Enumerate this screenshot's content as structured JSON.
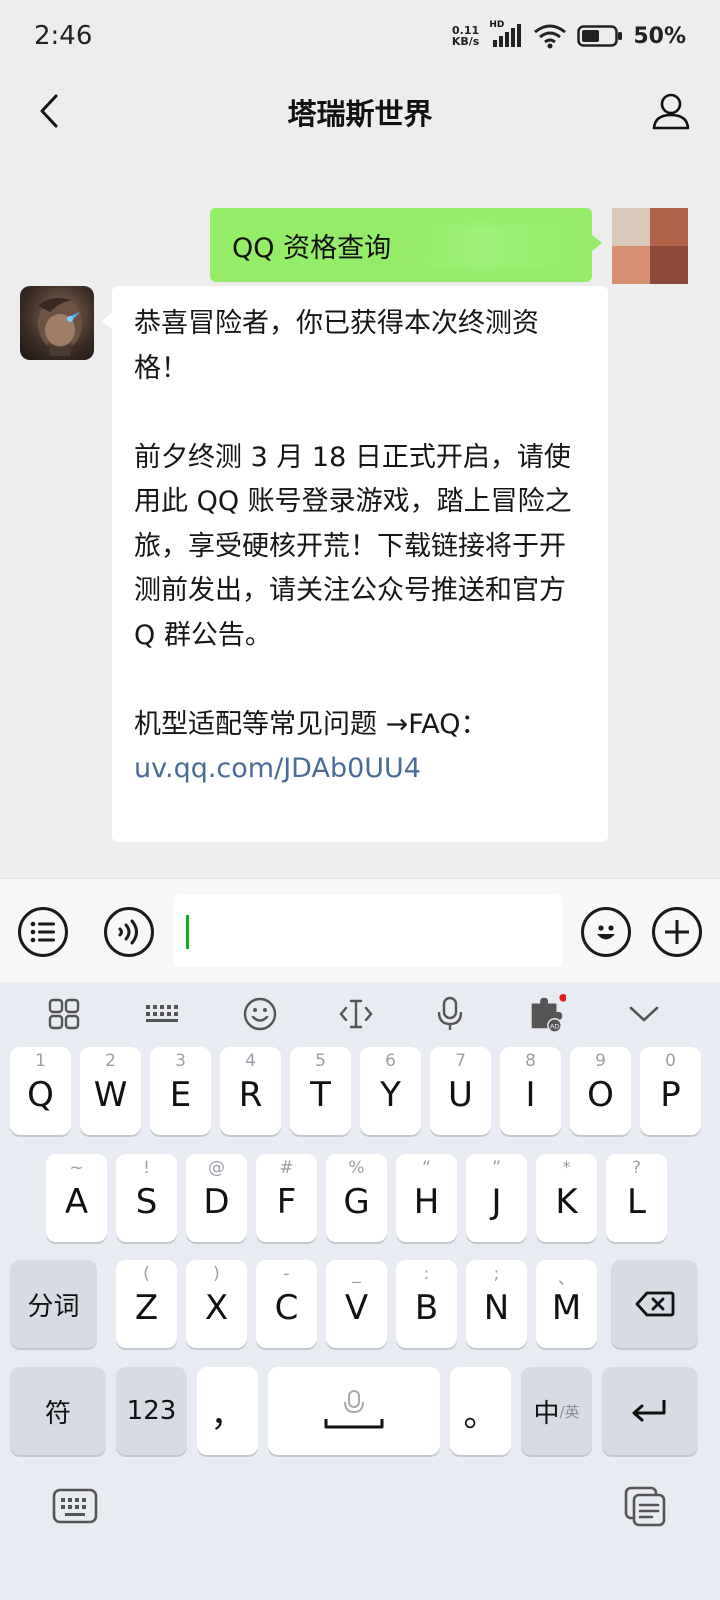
{
  "status_bar": {
    "time": "2:46",
    "net_speed_value": "0.11",
    "net_speed_unit": "KB/s",
    "network": "HD",
    "battery": "50%"
  },
  "header": {
    "title": "塔瑞斯世界"
  },
  "messages": {
    "outgoing": {
      "text": "QQ 资格查询"
    },
    "incoming": {
      "paragraph1": "恭喜冒险者，你已获得本次终测资格！",
      "paragraph2": "前夕终测 3 月 18 日正式开启，请使用此 QQ 账号登录游戏，踏上冒险之旅，享受硬核开荒！下载链接将于开测前发出，请关注公众号推送和官方 Q 群公告。",
      "faq_label": "机型适配等常见问题 →FAQ：",
      "faq_link": "uv.qq.com/JDAb0UU4"
    }
  },
  "input": {
    "value": ""
  },
  "keyboard": {
    "row1": [
      {
        "key": "Q",
        "hint": "1"
      },
      {
        "key": "W",
        "hint": "2"
      },
      {
        "key": "E",
        "hint": "3"
      },
      {
        "key": "R",
        "hint": "4"
      },
      {
        "key": "T",
        "hint": "5"
      },
      {
        "key": "Y",
        "hint": "6"
      },
      {
        "key": "U",
        "hint": "7"
      },
      {
        "key": "I",
        "hint": "8"
      },
      {
        "key": "O",
        "hint": "9"
      },
      {
        "key": "P",
        "hint": "0"
      }
    ],
    "row2": [
      {
        "key": "A",
        "hint": "~"
      },
      {
        "key": "S",
        "hint": "!"
      },
      {
        "key": "D",
        "hint": "@"
      },
      {
        "key": "F",
        "hint": "#"
      },
      {
        "key": "G",
        "hint": "%"
      },
      {
        "key": "H",
        "hint": "“"
      },
      {
        "key": "J",
        "hint": "”"
      },
      {
        "key": "K",
        "hint": "*"
      },
      {
        "key": "L",
        "hint": "?"
      }
    ],
    "row3": [
      {
        "key": "Z",
        "hint": "("
      },
      {
        "key": "X",
        "hint": ")"
      },
      {
        "key": "C",
        "hint": "-"
      },
      {
        "key": "V",
        "hint": "_"
      },
      {
        "key": "B",
        "hint": ":"
      },
      {
        "key": "N",
        "hint": ";"
      },
      {
        "key": "M",
        "hint": "、"
      }
    ],
    "segment_label": "分词",
    "symbol_label": "符",
    "number_label": "123",
    "comma_label": "，",
    "period_label": "。",
    "lang_main": "中",
    "lang_alt": "/英",
    "badge_text": "AD"
  }
}
